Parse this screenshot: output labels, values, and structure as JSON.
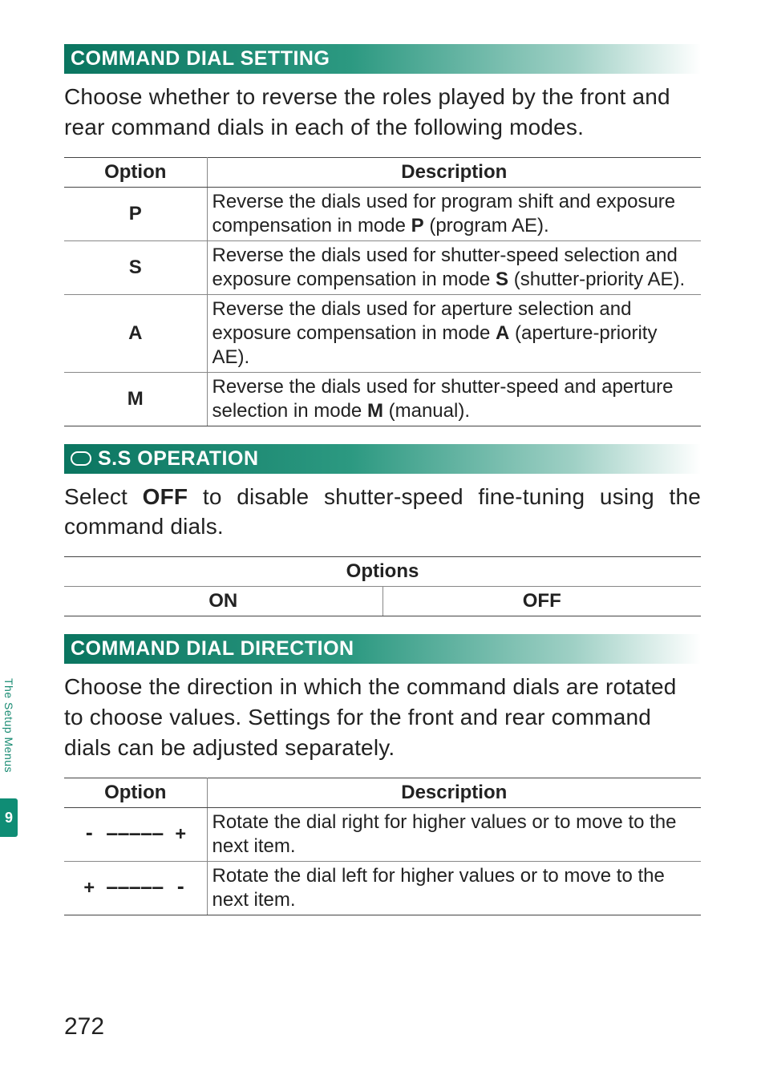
{
  "sections": {
    "commandDialSetting": {
      "title": "COMMAND DIAL SETTING",
      "intro": "Choose whether to reverse the roles played by the front and rear command dials in each of the following modes.",
      "headers": {
        "option": "Option",
        "description": "Description"
      },
      "rows": [
        {
          "opt": "P",
          "pre": "Reverse the dials used for program shift and exposure compensation in mode ",
          "bold": "P",
          "post": " (program AE)."
        },
        {
          "opt": "S",
          "pre": "Reverse the dials used for shutter-speed selection and exposure compensation in mode ",
          "bold": "S",
          "post": " (shutter-priority AE)."
        },
        {
          "opt": "A",
          "pre": "Reverse the dials used for aperture selection and exposure compensation in mode ",
          "bold": "A",
          "post": " (aperture-priority AE)."
        },
        {
          "opt": "M",
          "pre": "Reverse the dials used for shutter-speed and aperture selection in mode ",
          "bold": "M",
          "post": " (manual)."
        }
      ]
    },
    "ssOperation": {
      "iconName": "shutter-speed-icon",
      "title": "S.S OPERATION",
      "intro_pre": "Select ",
      "intro_bold": "OFF",
      "intro_post": " to disable shutter-speed fine-tuning using the command dials.",
      "optionsHeader": "Options",
      "options": {
        "on": "ON",
        "off": "OFF"
      }
    },
    "commandDialDirection": {
      "title": "COMMAND DIAL DIRECTION",
      "intro": "Choose the direction in which the command dials are rotated to choose values. Settings for the front and rear command dials can be adjusted separately.",
      "headers": {
        "option": "Option",
        "description": "Description"
      },
      "rows": [
        {
          "icon": "- ‒‒‒‒‒ +",
          "iconName": "dial-direction-normal-icon",
          "desc": "Rotate the dial right for higher values or to move to the next item."
        },
        {
          "icon": "+ ‒‒‒‒‒ -",
          "iconName": "dial-direction-reverse-icon",
          "desc": "Rotate the dial left for higher values or to move to the next item."
        }
      ]
    }
  },
  "sidebar": {
    "label": "The Setup Menus",
    "chapter": "9"
  },
  "pageNumber": "272"
}
